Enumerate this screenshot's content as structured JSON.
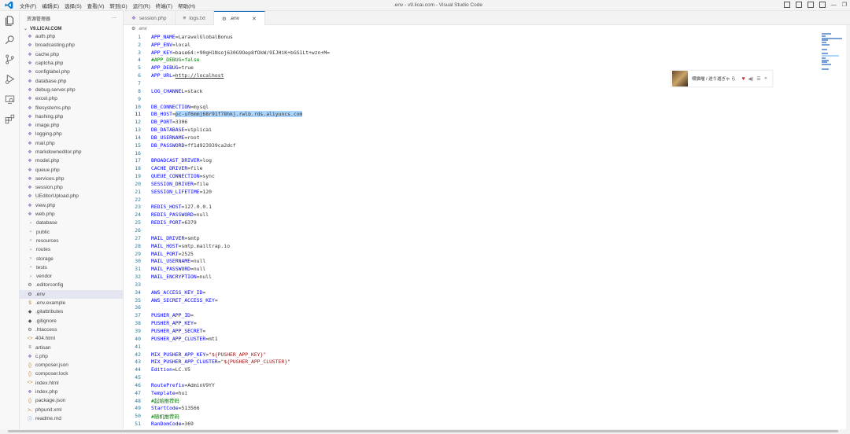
{
  "titlebar": {
    "menu": [
      "文件(F)",
      "编辑(E)",
      "选择(S)",
      "查看(V)",
      "转到(G)",
      "运行(R)",
      "终端(T)",
      "帮助(H)"
    ],
    "window_title": ".env - v9.licai.com - Visual Studio Code"
  },
  "sidebar": {
    "header": "资源管理器",
    "more": "···",
    "root": "V9.LICAI.COM",
    "items": [
      {
        "label": "auth.php",
        "icon": "php"
      },
      {
        "label": "broadcasting.php",
        "icon": "php"
      },
      {
        "label": "cache.php",
        "icon": "php"
      },
      {
        "label": "captcha.php",
        "icon": "php"
      },
      {
        "label": "configlabel.php",
        "icon": "php"
      },
      {
        "label": "database.php",
        "icon": "php"
      },
      {
        "label": "debug-server.php",
        "icon": "php"
      },
      {
        "label": "excel.php",
        "icon": "php"
      },
      {
        "label": "filesystems.php",
        "icon": "php"
      },
      {
        "label": "hashing.php",
        "icon": "php"
      },
      {
        "label": "image.php",
        "icon": "php"
      },
      {
        "label": "logging.php",
        "icon": "php"
      },
      {
        "label": "mail.php",
        "icon": "php"
      },
      {
        "label": "markdowneditor.php",
        "icon": "php"
      },
      {
        "label": "model.php",
        "icon": "php"
      },
      {
        "label": "queue.php",
        "icon": "php"
      },
      {
        "label": "services.php",
        "icon": "php"
      },
      {
        "label": "session.php",
        "icon": "php"
      },
      {
        "label": "UEditorUpload.php",
        "icon": "php"
      },
      {
        "label": "view.php",
        "icon": "php"
      },
      {
        "label": "web.php",
        "icon": "php"
      },
      {
        "label": "database",
        "icon": "folder"
      },
      {
        "label": "public",
        "icon": "folder"
      },
      {
        "label": "resources",
        "icon": "folder"
      },
      {
        "label": "routes",
        "icon": "folder"
      },
      {
        "label": "storage",
        "icon": "folder"
      },
      {
        "label": "tests",
        "icon": "folder"
      },
      {
        "label": "vendor",
        "icon": "folder"
      },
      {
        "label": ".editorconfig",
        "icon": "gear"
      },
      {
        "label": ".env",
        "icon": "gear",
        "selected": true
      },
      {
        "label": ".env.example",
        "icon": "dollar"
      },
      {
        "label": ".gitattributes",
        "icon": "git"
      },
      {
        "label": ".gitignore",
        "icon": "git"
      },
      {
        "label": ".htaccess",
        "icon": "gear"
      },
      {
        "label": "404.html",
        "icon": "html"
      },
      {
        "label": "artisan",
        "icon": "lines"
      },
      {
        "label": "c.php",
        "icon": "php"
      },
      {
        "label": "composer.json",
        "icon": "json"
      },
      {
        "label": "composer.lock",
        "icon": "json"
      },
      {
        "label": "index.html",
        "icon": "html"
      },
      {
        "label": "index.php",
        "icon": "php"
      },
      {
        "label": "package.json",
        "icon": "json"
      },
      {
        "label": "phpunit.xml",
        "icon": "xml"
      },
      {
        "label": "readme.md",
        "icon": "info"
      }
    ]
  },
  "tabs": [
    {
      "label": "session.php",
      "icon": "php"
    },
    {
      "label": "logs.txt",
      "icon": "lines"
    },
    {
      "label": ".env",
      "icon": "gear",
      "active": true
    }
  ],
  "breadcrumb": ".env",
  "editor": {
    "current_line": 11,
    "lines": [
      {
        "n": "1",
        "k": "APP_NAME",
        "v": "LaravelGlobalBonus"
      },
      {
        "n": "2",
        "k": "APP_ENV",
        "v": "local"
      },
      {
        "n": "3",
        "k": "APP_KEY",
        "v": "base64:+90gH1Nsoj630G9Oep8fOkW/9IJHiK+bGS1Lt+wzn+M="
      },
      {
        "n": "4",
        "c": "#APP_DEBUG=false"
      },
      {
        "n": "5",
        "k": "APP_DEBUG",
        "v": "true"
      },
      {
        "n": "6",
        "k": "APP_URL",
        "v": "http://localhost",
        "underline": true
      },
      {
        "n": "7"
      },
      {
        "n": "8",
        "k": "LOG_CHANNEL",
        "v": "stack"
      },
      {
        "n": "9"
      },
      {
        "n": "10",
        "k": "DB_CONNECTION",
        "v": "mysql"
      },
      {
        "n": "11",
        "k": "DB_HOST",
        "v": "pc-uf6mmj68r91f78hkj.rwlb.rds.aliyuncs.com",
        "highlight": true
      },
      {
        "n": "12",
        "k": "DB_PORT",
        "v": "3306"
      },
      {
        "n": "13",
        "k": "DB_DATABASE",
        "v": "viplicai"
      },
      {
        "n": "14",
        "k": "DB_USERNAME",
        "v": "root"
      },
      {
        "n": "15",
        "k": "DB_PASSWORD",
        "v": "ff1d923939ca2dcf"
      },
      {
        "n": "16"
      },
      {
        "n": "17",
        "k": "BROADCAST_DRIVER",
        "v": "log"
      },
      {
        "n": "18",
        "k": "CACHE_DRIVER",
        "v": "file"
      },
      {
        "n": "19",
        "k": "QUEUE_CONNECTION",
        "v": "sync"
      },
      {
        "n": "20",
        "k": "SESSION_DRIVER",
        "v": "file"
      },
      {
        "n": "21",
        "k": "SESSION_LIFETIME",
        "v": "120"
      },
      {
        "n": "22"
      },
      {
        "n": "23",
        "k": "REDIS_HOST",
        "v": "127.0.0.1"
      },
      {
        "n": "24",
        "k": "REDIS_PASSWORD",
        "v": "null"
      },
      {
        "n": "25",
        "k": "REDIS_PORT",
        "v": "6379"
      },
      {
        "n": "26"
      },
      {
        "n": "27",
        "k": "MAIL_DRIVER",
        "v": "smtp"
      },
      {
        "n": "28",
        "k": "MAIL_HOST",
        "v": "smtp.mailtrap.io"
      },
      {
        "n": "29",
        "k": "MAIL_PORT",
        "v": "2525"
      },
      {
        "n": "30",
        "k": "MAIL_USERNAME",
        "v": "null"
      },
      {
        "n": "31",
        "k": "MAIL_PASSWORD",
        "v": "null"
      },
      {
        "n": "32",
        "k": "MAIL_ENCRYPTION",
        "v": "null"
      },
      {
        "n": "33"
      },
      {
        "n": "34",
        "k": "AWS_ACCESS_KEY_ID",
        "v": ""
      },
      {
        "n": "35",
        "k": "AWS_SECRET_ACCESS_KEY",
        "v": ""
      },
      {
        "n": "36"
      },
      {
        "n": "37",
        "k": "PUSHER_APP_ID",
        "v": ""
      },
      {
        "n": "38",
        "k": "PUSHER_APP_KEY",
        "v": ""
      },
      {
        "n": "39",
        "k": "PUSHER_APP_SECRET",
        "v": ""
      },
      {
        "n": "40",
        "k": "PUSHER_APP_CLUSTER",
        "v": "mt1"
      },
      {
        "n": "41"
      },
      {
        "n": "42",
        "k": "MIX_PUSHER_APP_KEY",
        "v": "\"${PUSHER_APP_KEY}\"",
        "string": true
      },
      {
        "n": "43",
        "k": "MIX_PUSHER_APP_CLUSTER",
        "v": "\"${PUSHER_APP_CLUSTER}\"",
        "string": true
      },
      {
        "n": "44",
        "k": "Edition",
        "v": "LC.V5"
      },
      {
        "n": "45"
      },
      {
        "n": "46",
        "k": "RoutePrefix",
        "v": "AdminV9YY"
      },
      {
        "n": "47",
        "k": "Template",
        "v": "hui"
      },
      {
        "n": "48",
        "c": "#起始推荐码"
      },
      {
        "n": "49",
        "k": "StartCode",
        "v": "513566"
      },
      {
        "n": "50",
        "c": "#随机推荐码"
      },
      {
        "n": "51",
        "k": "RanDomCode",
        "v": "369"
      }
    ]
  },
  "music_widget": {
    "song": "喂猫喵 / 途り遊ぎゃ ら"
  },
  "colors": {
    "key": "#0000ff",
    "comment": "#008000",
    "string": "#a31515",
    "line_number": "#237893",
    "selection": "#add6ff",
    "accent": "#005fb8"
  }
}
